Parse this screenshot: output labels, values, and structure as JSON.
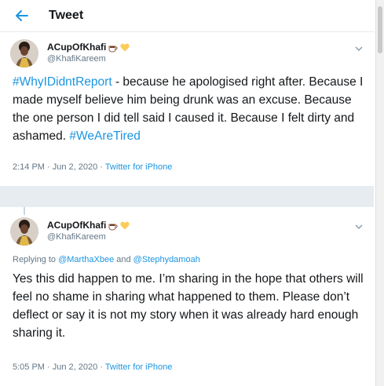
{
  "header": {
    "title": "Tweet",
    "back_icon": "arrow-left-icon"
  },
  "colors": {
    "accent": "#1b95e0",
    "text": "#14171a",
    "muted": "#657786",
    "divider": "#e6ecf0"
  },
  "tweets": [
    {
      "display_name": "ACupOfKhafi",
      "emojis": [
        "coffee-icon",
        "yellow-heart-icon"
      ],
      "handle": "@KhafiKareem",
      "hashtag1": "#WhyIDidntReport",
      "text1": " - because he apologised right after. Because I made myself believe him being drunk was an excuse. Because the one person I did tell said I caused it. Because I felt dirty and ashamed. ",
      "hashtag2": "#WeAreTired",
      "timestamp": "2:14 PM · Jun 2, 2020 · ",
      "source": "Twitter for iPhone"
    },
    {
      "display_name": "ACupOfKhafi",
      "emojis": [
        "coffee-icon",
        "yellow-heart-icon"
      ],
      "handle": "@KhafiKareem",
      "replying_prefix": "Replying to ",
      "mention1": "@MarthaXbee",
      "replying_and": " and ",
      "mention2": "@Stephydamoah",
      "text": "Yes this did happen to me. I’m sharing in the hope that others will feel no shame in sharing what happened to them. Please don’t deflect or say it is not my story when it was already hard enough sharing it.",
      "timestamp": "5:05 PM · Jun 2, 2020 · ",
      "source": "Twitter for iPhone"
    }
  ]
}
